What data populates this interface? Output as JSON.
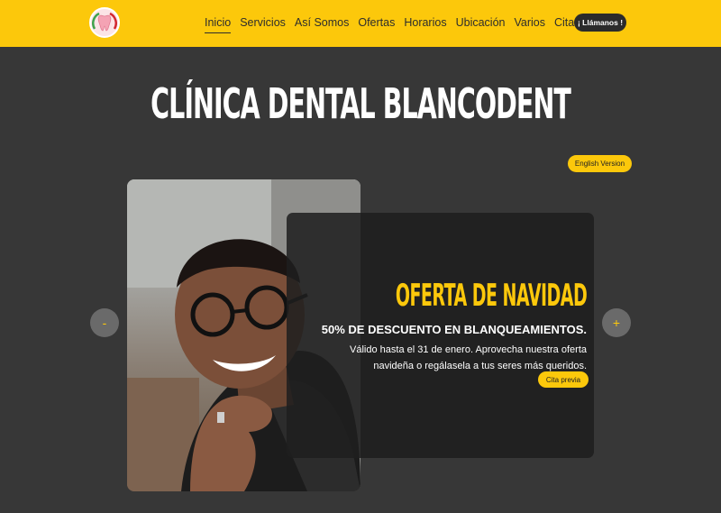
{
  "header": {
    "nav": [
      {
        "label": "Inicio",
        "active": true
      },
      {
        "label": "Servicios",
        "active": false
      },
      {
        "label": "Así Somos",
        "active": false
      },
      {
        "label": "Ofertas",
        "active": false
      },
      {
        "label": "Horarios",
        "active": false
      },
      {
        "label": "Ubicación",
        "active": false
      },
      {
        "label": "Varios",
        "active": false
      },
      {
        "label": "Cita Previa",
        "active": false
      }
    ],
    "call_label": "¡ Llámanos !"
  },
  "page_title": "CLÍNICA DENTAL BLANCODENT",
  "language_button": "English Version",
  "slider": {
    "prev_label": "-",
    "next_label": "+",
    "offer": {
      "title": "OFERTA DE NAVIDAD",
      "subtitle": "50% DE DESCUENTO EN BLANQUEAMIENTOS.",
      "description": "Válido hasta el 31 de enero. Aprovecha nuestra oferta navideña o regálasela a tus seres más queridos.",
      "button_label": "Cita previa"
    }
  },
  "colors": {
    "accent": "#fcc80b",
    "background": "#373737",
    "card": "#1e1e1e"
  },
  "icons": {
    "logo": "tooth-logo-icon",
    "photo": "smiling-man-with-glasses-photo"
  }
}
